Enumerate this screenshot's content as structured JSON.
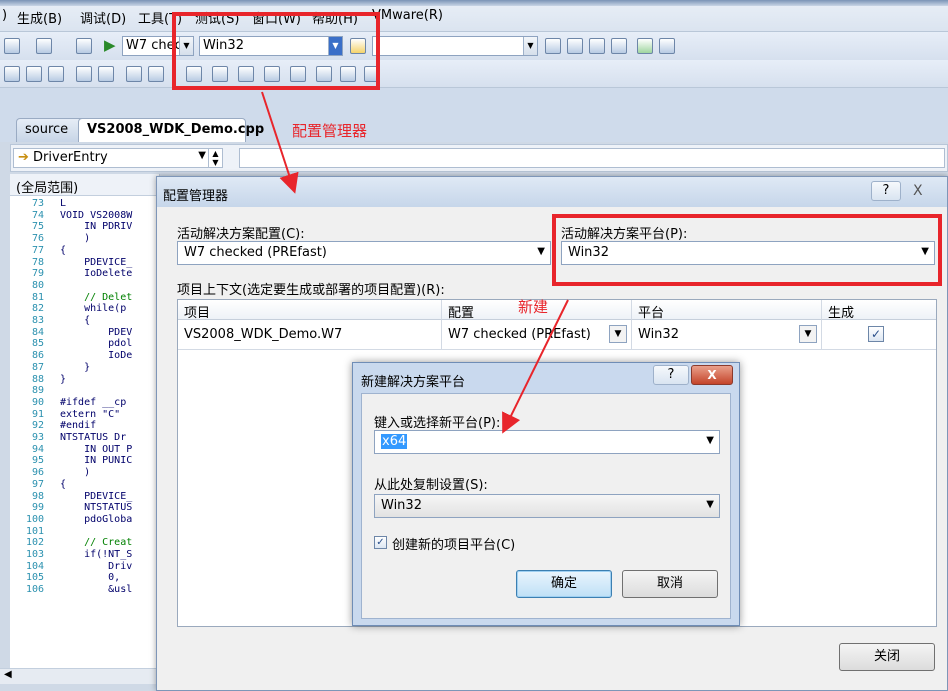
{
  "menu": {
    "items": [
      ")",
      "生成(B)",
      "调试(D)",
      "工具(T)",
      "测试(S)",
      "窗口(W)",
      "帮助(H)",
      "VMware(R)"
    ]
  },
  "toolbar": {
    "config_value": "W7 checke",
    "platform_value": "Win32"
  },
  "tabs": {
    "left_tab": "source",
    "active_tab": "VS2008_WDK_Demo.cpp"
  },
  "navbar": {
    "function": "DriverEntry"
  },
  "editor": {
    "scope": "(全局范围)",
    "lines": [
      {
        "n": "73",
        "t": "L"
      },
      {
        "n": "74",
        "t": "VOID VS2008W"
      },
      {
        "n": "75",
        "t": "    IN PDRIV"
      },
      {
        "n": "76",
        "t": "    )"
      },
      {
        "n": "77",
        "t": "{"
      },
      {
        "n": "78",
        "t": "    PDEVICE_"
      },
      {
        "n": "79",
        "t": "    IoDelete"
      },
      {
        "n": "80",
        "t": ""
      },
      {
        "n": "81",
        "t": "    // Delet"
      },
      {
        "n": "82",
        "t": "    while(p"
      },
      {
        "n": "83",
        "t": "    {"
      },
      {
        "n": "84",
        "t": "        PDEV"
      },
      {
        "n": "85",
        "t": "        pdol"
      },
      {
        "n": "86",
        "t": "        IoDe"
      },
      {
        "n": "87",
        "t": "    }"
      },
      {
        "n": "88",
        "t": "}"
      },
      {
        "n": "89",
        "t": ""
      },
      {
        "n": "90",
        "t": "#ifdef __cp"
      },
      {
        "n": "91",
        "t": "extern \"C\""
      },
      {
        "n": "92",
        "t": "#endif"
      },
      {
        "n": "93",
        "t": "NTSTATUS Dr"
      },
      {
        "n": "94",
        "t": "    IN OUT P"
      },
      {
        "n": "95",
        "t": "    IN PUNIC"
      },
      {
        "n": "96",
        "t": "    )"
      },
      {
        "n": "97",
        "t": "{"
      },
      {
        "n": "98",
        "t": "    PDEVICE_"
      },
      {
        "n": "99",
        "t": "    NTSTATUS"
      },
      {
        "n": "100",
        "t": "    pdoGloba"
      },
      {
        "n": "101",
        "t": ""
      },
      {
        "n": "102",
        "t": "    // Creat"
      },
      {
        "n": "103",
        "t": "    if(!NT_S"
      },
      {
        "n": "104",
        "t": "        Driv"
      },
      {
        "n": "105",
        "t": "        0,"
      },
      {
        "n": "106",
        "t": "        &usl"
      }
    ]
  },
  "config_dialog": {
    "title": "配置管理器",
    "help_glyph": "?",
    "close_glyph": "X",
    "active_config_label": "活动解决方案配置(C):",
    "active_config_value": "W7 checked (PREfast)",
    "active_platform_label": "活动解决方案平台(P):",
    "active_platform_value": "Win32",
    "project_context_label": "项目上下文(选定要生成或部署的项目配置)(R):",
    "columns": [
      "项目",
      "配置",
      "平台",
      "生成"
    ],
    "rows": [
      {
        "project": "VS2008_WDK_Demo.W7",
        "config": "W7 checked (PREfast)",
        "platform": "Win32",
        "build": true
      }
    ],
    "close_button": "关闭"
  },
  "new_platform_dialog": {
    "title": "新建解决方案平台",
    "help_glyph": "?",
    "close_glyph": "X",
    "new_platform_label": "键入或选择新平台(P):",
    "new_platform_value": "x64",
    "copy_from_label": "从此处复制设置(S):",
    "copy_from_value": "Win32",
    "create_checkbox_label": "创建新的项目平台(C)",
    "create_checked": true,
    "ok_button": "确定",
    "cancel_button": "取消"
  },
  "annotations": {
    "config_manager_note": "配置管理器",
    "new_note": "新建",
    "color": "#e8252b"
  }
}
